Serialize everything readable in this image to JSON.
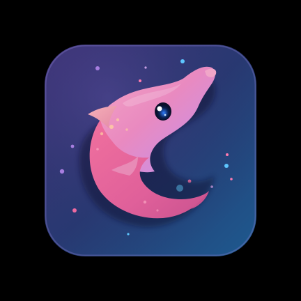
{
  "icon": {
    "name": "pink-dolphin-app-icon",
    "colors": {
      "page_background": "#000000",
      "tile_top_left": "#3b2f6e",
      "tile_bottom_right": "#1f4f86",
      "tile_center": "#283a73",
      "creature_light": "#f2a0c8",
      "creature_mid": "#ee6aa0",
      "creature_dark": "#c9528f",
      "creature_lavender": "#c9a0e6",
      "eye_blue": "#1c6cff",
      "sparkle_pink": "#ff7ab0",
      "sparkle_cyan": "#5ec6ff",
      "sparkle_purple": "#a77ee0"
    }
  }
}
